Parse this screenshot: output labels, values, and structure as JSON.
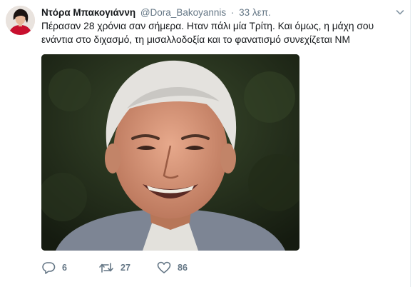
{
  "tweet": {
    "author_name": "Ντόρα Μπακογιάννη",
    "handle": "@Dora_Bakoyannis",
    "separator": "·",
    "time": "33 λεπ.",
    "text": "Πέρασαν 28 χρόνια σαν σήμερα. Ηταν πάλι μία Τρίτη. Και όμως, η μάχη σου ενάντια στο διχασμό, τη μισαλλοδοξία και το φανατισμό συνεχίζεται ΝΜ",
    "actions": {
      "reply_count": "6",
      "retweet_count": "27",
      "like_count": "86"
    }
  },
  "icons": {
    "reply": "reply-bubble-icon",
    "retweet": "retweet-arrows-icon",
    "like": "heart-icon",
    "menu": "chevron-down-icon"
  },
  "colors": {
    "text_primary": "#14171a",
    "text_secondary": "#657786",
    "divider": "#e6ecf0"
  }
}
